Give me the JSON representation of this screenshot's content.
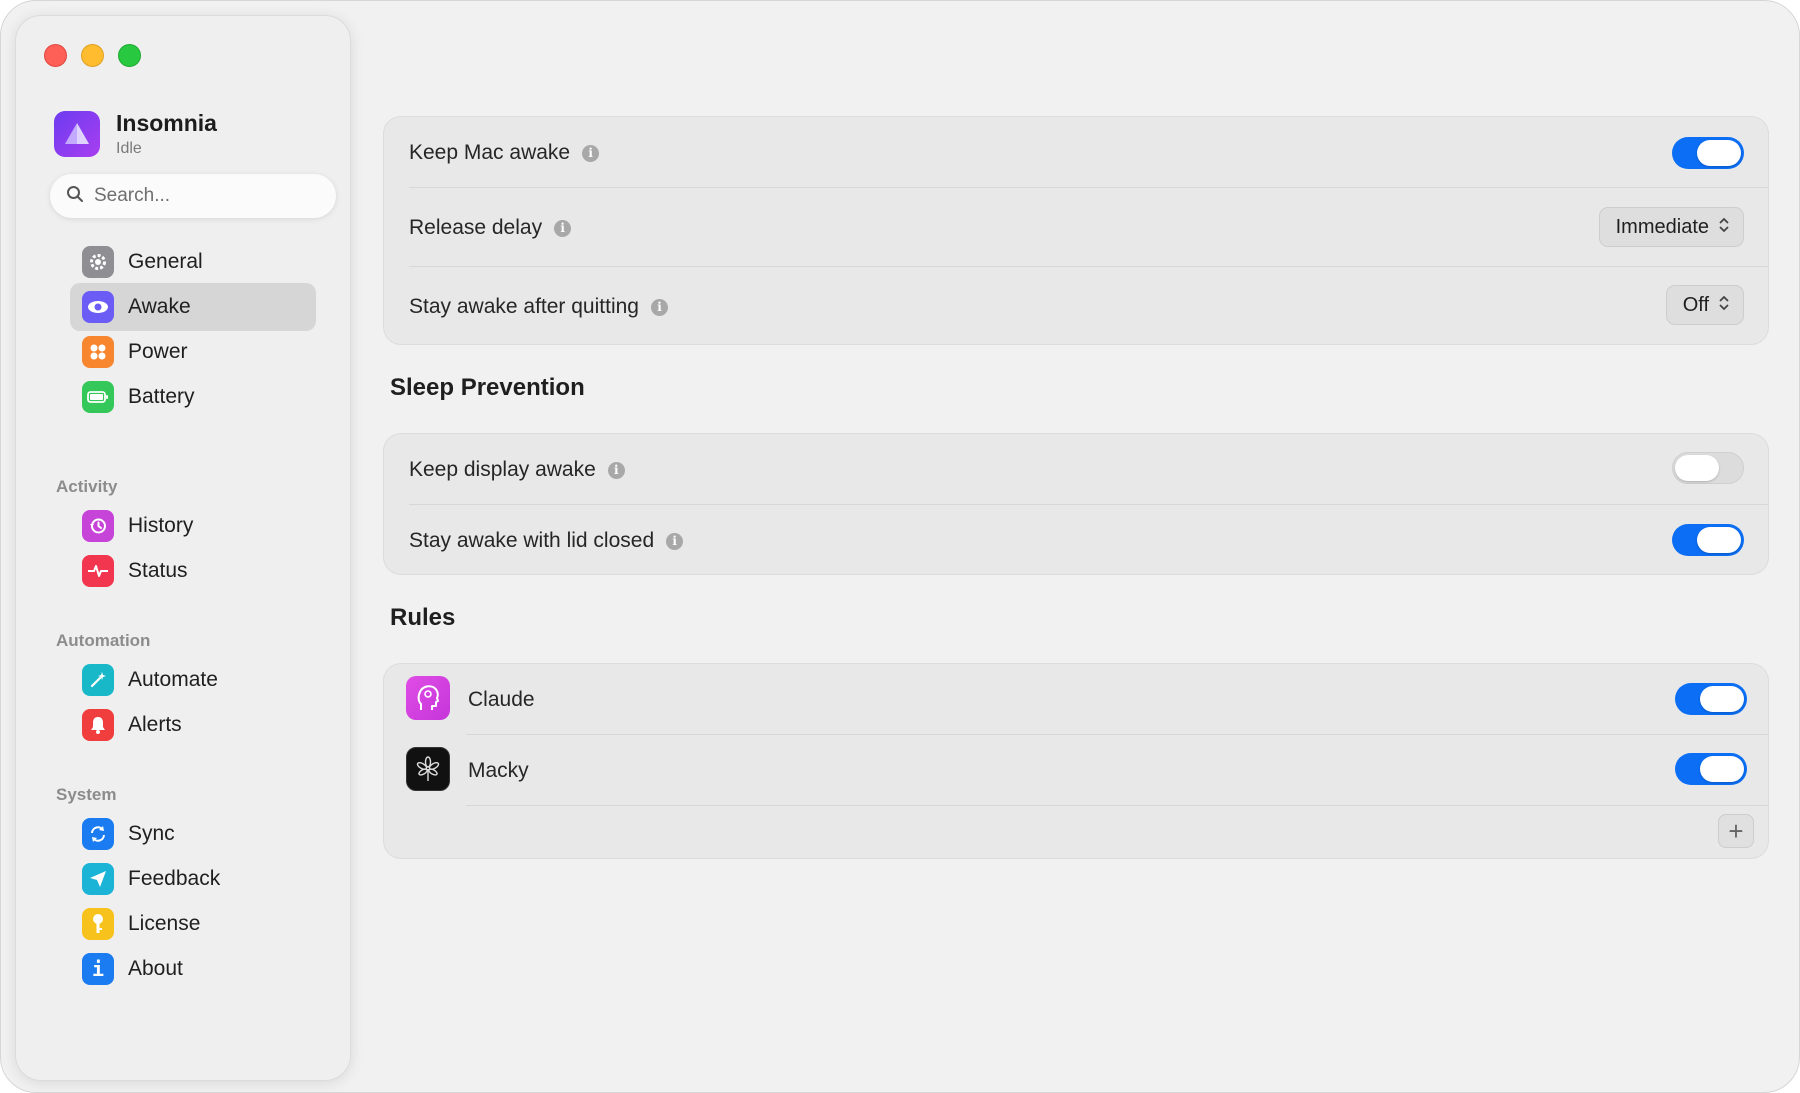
{
  "app": {
    "name": "Insomnia",
    "status": "Idle"
  },
  "search": {
    "placeholder": "Search..."
  },
  "sidebar": {
    "items": [
      {
        "label": "General",
        "icon": "gear-icon",
        "color": "#8e8e93"
      },
      {
        "label": "Awake",
        "icon": "eye-icon",
        "color": "#6a5cf5",
        "selected": true
      },
      {
        "label": "Power",
        "icon": "power-icon",
        "color": "#f7862f"
      },
      {
        "label": "Battery",
        "icon": "battery-icon",
        "color": "#34c759"
      }
    ],
    "activity_label": "Activity",
    "activity": [
      {
        "label": "History",
        "icon": "history-icon",
        "color": "#c744d8"
      },
      {
        "label": "Status",
        "icon": "heartbeat-icon",
        "color": "#f2364f"
      }
    ],
    "automation_label": "Automation",
    "automation": [
      {
        "label": "Automate",
        "icon": "magic-wand-icon",
        "color": "#18b8c9"
      },
      {
        "label": "Alerts",
        "icon": "bell-icon",
        "color": "#f03e3e"
      }
    ],
    "system_label": "System",
    "system": [
      {
        "label": "Sync",
        "icon": "sync-icon",
        "color": "#1a7cf0"
      },
      {
        "label": "Feedback",
        "icon": "paper-plane-icon",
        "color": "#1bb3d6"
      },
      {
        "label": "License",
        "icon": "key-icon",
        "color": "#f7c21b"
      },
      {
        "label": "About",
        "icon": "info-icon",
        "color": "#1a7cf0"
      }
    ]
  },
  "main": {
    "general_rows": [
      {
        "label": "Keep Mac awake",
        "control": "toggle",
        "on": true
      },
      {
        "label": "Release delay",
        "control": "popup",
        "value": "Immediate"
      },
      {
        "label": "Stay awake after quitting",
        "control": "popup",
        "value": "Off"
      }
    ],
    "sleep_prevention_title": "Sleep Prevention",
    "sleep_rows": [
      {
        "label": "Keep display awake",
        "control": "toggle",
        "on": false
      },
      {
        "label": "Stay awake with lid closed",
        "control": "toggle",
        "on": true
      }
    ],
    "rules_title": "Rules",
    "rules": [
      {
        "label": "Claude",
        "on": true,
        "icon": "head-profile-icon",
        "color": "#d63ee0"
      },
      {
        "label": "Macky",
        "on": true,
        "icon": "flower-icon",
        "color": "#111111"
      }
    ],
    "add_label": "+"
  },
  "colors": {
    "accent": "#0b6ef5",
    "selected_bg": "#d6d6d6"
  }
}
